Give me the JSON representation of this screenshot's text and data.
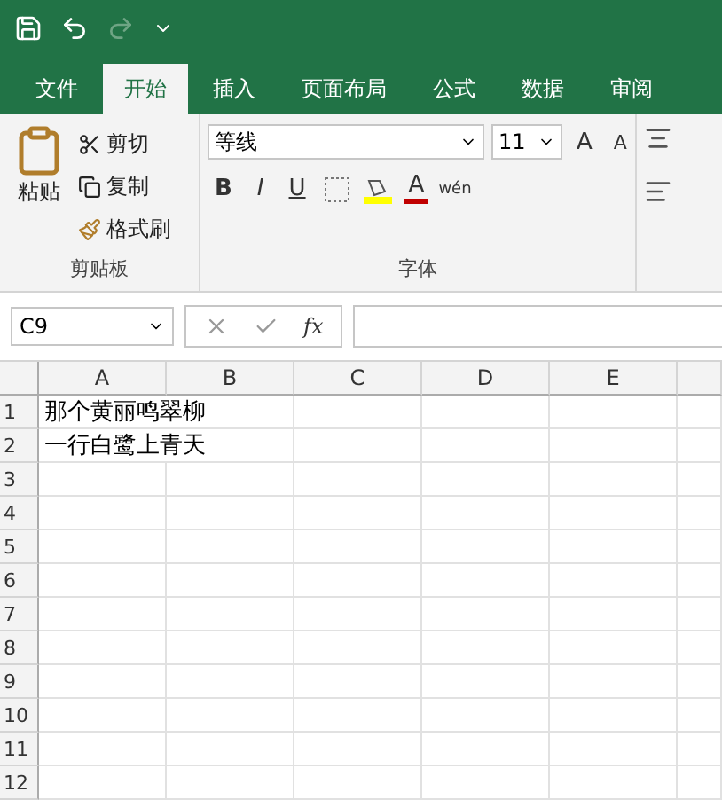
{
  "tabs": [
    {
      "label": "文件",
      "selected": false
    },
    {
      "label": "开始",
      "selected": true
    },
    {
      "label": "插入",
      "selected": false
    },
    {
      "label": "页面布局",
      "selected": false
    },
    {
      "label": "公式",
      "selected": false
    },
    {
      "label": "数据",
      "selected": false
    },
    {
      "label": "审阅",
      "selected": false
    }
  ],
  "clipboard": {
    "paste": "粘贴",
    "cut": "剪切",
    "copy": "复制",
    "format_painter": "格式刷",
    "group_label": "剪贴板"
  },
  "font": {
    "name": "等线",
    "size": "11",
    "grow": "A",
    "shrink": "A",
    "bold": "B",
    "italic": "I",
    "underline": "U",
    "font_color": "A",
    "phonetic": "wén",
    "group_label": "字体"
  },
  "formula_bar": {
    "name_box": "C9",
    "fx": "fx"
  },
  "sheet": {
    "columns": [
      "A",
      "B",
      "C",
      "D",
      "E"
    ],
    "rows": [
      {
        "header": "1",
        "cells": [
          "那个黄丽鸣翠柳"
        ]
      },
      {
        "header": "2",
        "cells": [
          "一行白鹭上青天"
        ]
      },
      {
        "header": "3",
        "cells": []
      },
      {
        "header": "4",
        "cells": []
      },
      {
        "header": "5",
        "cells": []
      },
      {
        "header": "6",
        "cells": []
      },
      {
        "header": "7",
        "cells": []
      },
      {
        "header": "8",
        "cells": []
      },
      {
        "header": "9",
        "cells": []
      },
      {
        "header": "10",
        "cells": []
      },
      {
        "header": "11",
        "cells": []
      },
      {
        "header": "12",
        "cells": []
      }
    ]
  }
}
